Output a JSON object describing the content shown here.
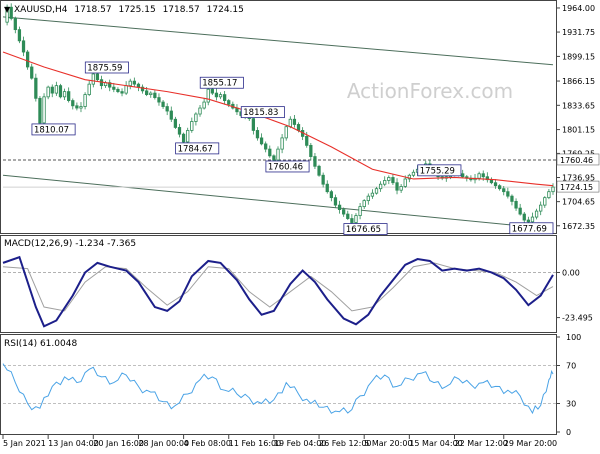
{
  "main_panel": {
    "symbol_header": "XAUUSD,H4",
    "ohlc": [
      "1718.57",
      "1725.15",
      "1718.57",
      "1724.15"
    ],
    "watermark": "ActionForex.com",
    "y_ticks": [
      "1964.00",
      "1931.75",
      "1899.15",
      "1866.15",
      "1833.65",
      "1801.15",
      "1769.25",
      "1736.95",
      "1704.65",
      "1672.35"
    ],
    "reference_line_label": "1760.46",
    "last_price_label": "1724.15",
    "colors": {
      "candle": "#2e8b57",
      "ma": "#e8302a",
      "channel": "#4c6e5b",
      "ref": "#555555",
      "last": "#d0d0d0"
    }
  },
  "macd_panel": {
    "header": "MACD(12,26,9) -1.234 -7.365",
    "y_ticks": [
      "0.00",
      "-23.495"
    ],
    "colors": {
      "macd": "#1c1f8a",
      "signal": "#a0a0a0"
    }
  },
  "rsi_panel": {
    "header": "RSI(14) 61.0048",
    "y_ticks": [
      "100",
      "70",
      "30",
      "0"
    ],
    "color": "#4aa3e6"
  },
  "x_axis_labels": [
    "5 Jan 2021",
    "13 Jan 04:00",
    "20 Jan 16:00",
    "28 Jan 00:00",
    "4 Feb 08:00",
    "11 Feb 16:00",
    "19 Feb 04:00",
    "26 Feb 12:00",
    "5 Mar 20:00",
    "15 Mar 04:00",
    "22 Mar 12:00",
    "29 Mar 20:00"
  ],
  "chart_data": {
    "type": "candlestick",
    "title": "XAUUSD,H4",
    "ylim": [
      1664,
      1972
    ],
    "price_path": [
      [
        0,
        1945
      ],
      [
        1,
        1965
      ],
      [
        2,
        1950
      ],
      [
        3,
        1935
      ],
      [
        4,
        1920
      ],
      [
        5,
        1905
      ],
      [
        6,
        1885
      ],
      [
        7,
        1870
      ],
      [
        8,
        1843
      ],
      [
        9,
        1810.07
      ],
      [
        10,
        1845
      ],
      [
        11,
        1858
      ],
      [
        12,
        1850
      ],
      [
        13,
        1860
      ],
      [
        14,
        1845
      ],
      [
        15,
        1852
      ],
      [
        16,
        1840
      ],
      [
        17,
        1833
      ],
      [
        18,
        1830
      ],
      [
        19,
        1832
      ],
      [
        20,
        1848
      ],
      [
        21,
        1862
      ],
      [
        22,
        1875.59
      ],
      [
        23,
        1868
      ],
      [
        24,
        1860
      ],
      [
        25,
        1864
      ],
      [
        26,
        1858
      ],
      [
        27,
        1855
      ],
      [
        28,
        1852
      ],
      [
        29,
        1850
      ],
      [
        30,
        1860
      ],
      [
        31,
        1866
      ],
      [
        32,
        1862
      ],
      [
        33,
        1858
      ],
      [
        34,
        1853
      ],
      [
        35,
        1848
      ],
      [
        36,
        1850
      ],
      [
        37,
        1844
      ],
      [
        38,
        1838
      ],
      [
        39,
        1832
      ],
      [
        40,
        1826
      ],
      [
        41,
        1815
      ],
      [
        42,
        1804
      ],
      [
        43,
        1795
      ],
      [
        44,
        1784.67
      ],
      [
        45,
        1800
      ],
      [
        46,
        1812
      ],
      [
        47,
        1822
      ],
      [
        48,
        1830
      ],
      [
        49,
        1838
      ],
      [
        50,
        1855.17
      ],
      [
        51,
        1850
      ],
      [
        52,
        1845
      ],
      [
        53,
        1848
      ],
      [
        54,
        1840
      ],
      [
        55,
        1835
      ],
      [
        56,
        1830
      ],
      [
        57,
        1825
      ],
      [
        58,
        1820
      ],
      [
        59,
        1822
      ],
      [
        60,
        1815.83
      ],
      [
        61,
        1800
      ],
      [
        62,
        1790
      ],
      [
        63,
        1782
      ],
      [
        64,
        1775
      ],
      [
        65,
        1766
      ],
      [
        66,
        1760.46
      ],
      [
        67,
        1775
      ],
      [
        68,
        1790
      ],
      [
        69,
        1805
      ],
      [
        70,
        1815
      ],
      [
        71,
        1808
      ],
      [
        72,
        1800
      ],
      [
        73,
        1792
      ],
      [
        74,
        1780
      ],
      [
        75,
        1765
      ],
      [
        76,
        1752
      ],
      [
        77,
        1740
      ],
      [
        78,
        1728
      ],
      [
        79,
        1718
      ],
      [
        80,
        1710
      ],
      [
        81,
        1700
      ],
      [
        82,
        1694
      ],
      [
        83,
        1688
      ],
      [
        84,
        1682
      ],
      [
        85,
        1676.65
      ],
      [
        86,
        1686
      ],
      [
        87,
        1698
      ],
      [
        88,
        1706
      ],
      [
        89,
        1712
      ],
      [
        90,
        1716
      ],
      [
        91,
        1722
      ],
      [
        92,
        1728
      ],
      [
        93,
        1733
      ],
      [
        94,
        1737
      ],
      [
        95,
        1730
      ],
      [
        96,
        1720
      ],
      [
        97,
        1725
      ],
      [
        98,
        1735
      ],
      [
        99,
        1740
      ],
      [
        100,
        1744
      ],
      [
        101,
        1748
      ],
      [
        102,
        1751
      ],
      [
        103,
        1755.29
      ],
      [
        104,
        1748
      ],
      [
        105,
        1742
      ],
      [
        106,
        1738
      ],
      [
        107,
        1736
      ],
      [
        108,
        1738
      ],
      [
        109,
        1744
      ],
      [
        110,
        1748
      ],
      [
        111,
        1742
      ],
      [
        112,
        1738
      ],
      [
        113,
        1736
      ],
      [
        114,
        1734
      ],
      [
        115,
        1736
      ],
      [
        116,
        1742
      ],
      [
        117,
        1738
      ],
      [
        118,
        1734
      ],
      [
        119,
        1730
      ],
      [
        120,
        1726
      ],
      [
        121,
        1722
      ],
      [
        122,
        1718
      ],
      [
        123,
        1712
      ],
      [
        124,
        1705
      ],
      [
        125,
        1696
      ],
      [
        126,
        1688
      ],
      [
        127,
        1680
      ],
      [
        128,
        1677.69
      ],
      [
        129,
        1684
      ],
      [
        130,
        1692
      ],
      [
        131,
        1700
      ],
      [
        132,
        1710
      ],
      [
        133,
        1718
      ],
      [
        134,
        1724.15
      ]
    ],
    "moving_average": [
      [
        0,
        1905
      ],
      [
        10,
        1885
      ],
      [
        20,
        1868
      ],
      [
        30,
        1860
      ],
      [
        40,
        1852
      ],
      [
        50,
        1842
      ],
      [
        60,
        1825
      ],
      [
        70,
        1805
      ],
      [
        80,
        1778
      ],
      [
        90,
        1748
      ],
      [
        100,
        1735
      ],
      [
        110,
        1737
      ],
      [
        120,
        1734
      ],
      [
        130,
        1728
      ],
      [
        134,
        1726
      ]
    ],
    "labeled_levels": [
      {
        "label": "1810.07",
        "x": 9,
        "value": 1810.07
      },
      {
        "label": "1875.59",
        "x": 22,
        "value": 1875.59
      },
      {
        "label": "1784.67",
        "x": 44,
        "value": 1784.67
      },
      {
        "label": "1855.17",
        "x": 50,
        "value": 1855.17
      },
      {
        "label": "1815.83",
        "x": 60,
        "value": 1815.83
      },
      {
        "label": "1760.46",
        "x": 66,
        "value": 1760.46
      },
      {
        "label": "1676.65",
        "x": 85,
        "value": 1676.65
      },
      {
        "label": "1755.29",
        "x": 103,
        "value": 1755.29
      },
      {
        "label": "1677.69",
        "x": 128,
        "value": 1677.69
      }
    ],
    "channel_upper": [
      [
        0,
        1952
      ],
      [
        134,
        1888
      ]
    ],
    "channel_lower": [
      [
        0,
        1740
      ],
      [
        134,
        1668
      ]
    ],
    "reference_level": 1760.46,
    "last_price": 1724.15,
    "macd": {
      "ylim": [
        -31,
        19
      ],
      "line": [
        [
          0,
          5
        ],
        [
          4,
          8
        ],
        [
          8,
          -18
        ],
        [
          10,
          -28
        ],
        [
          13,
          -25
        ],
        [
          17,
          -12
        ],
        [
          20,
          0
        ],
        [
          23,
          5
        ],
        [
          26,
          3
        ],
        [
          30,
          1
        ],
        [
          33,
          -5
        ],
        [
          37,
          -18
        ],
        [
          40,
          -20
        ],
        [
          43,
          -15
        ],
        [
          46,
          -2
        ],
        [
          50,
          6
        ],
        [
          53,
          5
        ],
        [
          57,
          -4
        ],
        [
          60,
          -14
        ],
        [
          63,
          -22
        ],
        [
          66,
          -20
        ],
        [
          70,
          -6
        ],
        [
          73,
          1
        ],
        [
          76,
          -5
        ],
        [
          79,
          -14
        ],
        [
          83,
          -24
        ],
        [
          86,
          -27
        ],
        [
          89,
          -22
        ],
        [
          92,
          -12
        ],
        [
          95,
          -4
        ],
        [
          98,
          4
        ],
        [
          101,
          7
        ],
        [
          104,
          6
        ],
        [
          107,
          1
        ],
        [
          110,
          2
        ],
        [
          113,
          1
        ],
        [
          116,
          2
        ],
        [
          119,
          0
        ],
        [
          122,
          -3
        ],
        [
          125,
          -9
        ],
        [
          128,
          -17
        ],
        [
          131,
          -12
        ],
        [
          134,
          -1.234
        ]
      ],
      "signal": [
        [
          0,
          3
        ],
        [
          6,
          2
        ],
        [
          10,
          -18
        ],
        [
          15,
          -20
        ],
        [
          20,
          -5
        ],
        [
          25,
          3
        ],
        [
          30,
          2
        ],
        [
          35,
          -8
        ],
        [
          40,
          -17
        ],
        [
          45,
          -10
        ],
        [
          50,
          3
        ],
        [
          55,
          2
        ],
        [
          60,
          -10
        ],
        [
          65,
          -18
        ],
        [
          70,
          -10
        ],
        [
          75,
          -2
        ],
        [
          80,
          -10
        ],
        [
          85,
          -20
        ],
        [
          90,
          -18
        ],
        [
          95,
          -8
        ],
        [
          100,
          3
        ],
        [
          105,
          5
        ],
        [
          110,
          2
        ],
        [
          115,
          1
        ],
        [
          120,
          0
        ],
        [
          125,
          -5
        ],
        [
          130,
          -12
        ],
        [
          134,
          -7.365
        ]
      ]
    },
    "rsi": {
      "ylim": [
        0,
        100
      ],
      "levels": [
        70,
        30
      ],
      "line": [
        [
          0,
          72
        ],
        [
          3,
          52
        ],
        [
          6,
          30
        ],
        [
          9,
          25
        ],
        [
          12,
          48
        ],
        [
          15,
          58
        ],
        [
          18,
          52
        ],
        [
          21,
          66
        ],
        [
          24,
          58
        ],
        [
          27,
          52
        ],
        [
          30,
          60
        ],
        [
          33,
          48
        ],
        [
          36,
          42
        ],
        [
          39,
          32
        ],
        [
          42,
          28
        ],
        [
          45,
          40
        ],
        [
          48,
          55
        ],
        [
          51,
          58
        ],
        [
          54,
          44
        ],
        [
          57,
          40
        ],
        [
          60,
          36
        ],
        [
          63,
          30
        ],
        [
          66,
          34
        ],
        [
          69,
          52
        ],
        [
          72,
          40
        ],
        [
          75,
          30
        ],
        [
          78,
          26
        ],
        [
          81,
          22
        ],
        [
          84,
          20
        ],
        [
          87,
          38
        ],
        [
          90,
          54
        ],
        [
          93,
          60
        ],
        [
          96,
          48
        ],
        [
          99,
          56
        ],
        [
          102,
          62
        ],
        [
          105,
          52
        ],
        [
          108,
          48
        ],
        [
          111,
          56
        ],
        [
          114,
          50
        ],
        [
          117,
          52
        ],
        [
          120,
          48
        ],
        [
          123,
          44
        ],
        [
          126,
          38
        ],
        [
          129,
          20
        ],
        [
          131,
          28
        ],
        [
          133,
          55
        ],
        [
          134,
          61.0048
        ]
      ]
    }
  }
}
